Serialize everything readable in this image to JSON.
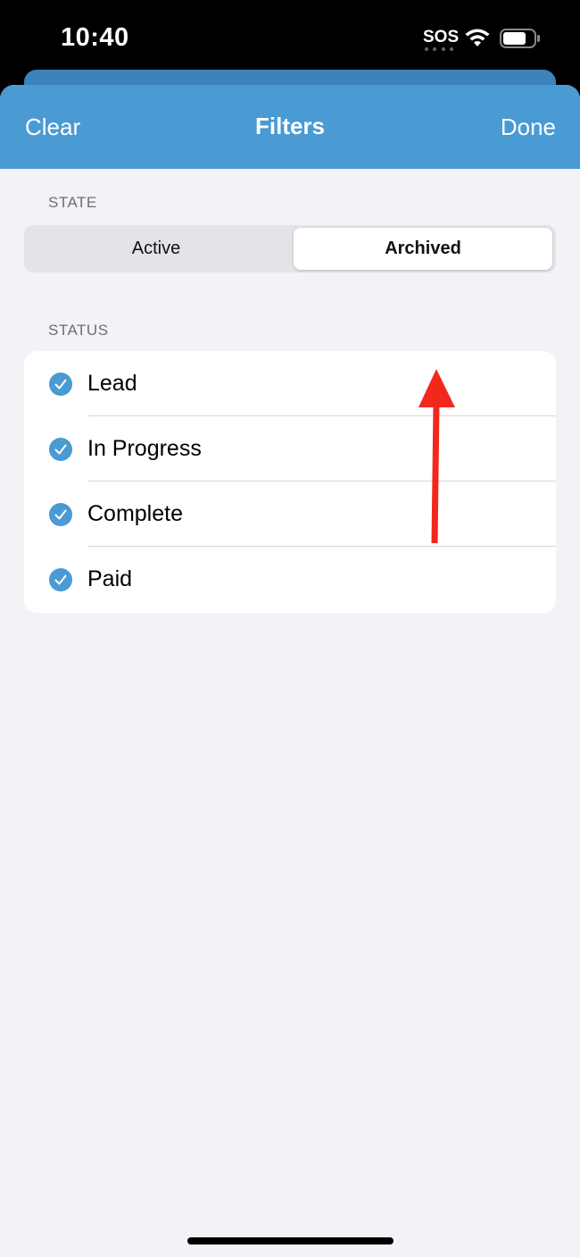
{
  "status_bar": {
    "time": "10:40",
    "sos": "SOS",
    "wifi_icon": "wifi-icon",
    "battery_icon": "battery-icon"
  },
  "nav": {
    "left_button": "Clear",
    "title": "Filters",
    "right_button": "Done",
    "background_color": "#4A9AD4"
  },
  "state_section": {
    "header": "STATE",
    "segments": [
      "Active",
      "Archived"
    ],
    "selected": "Archived"
  },
  "status_section": {
    "header": "STATUS",
    "items": [
      {
        "label": "Lead",
        "checked": true,
        "icon": "checkmark-circle-icon"
      },
      {
        "label": "In Progress",
        "checked": true,
        "icon": "checkmark-circle-icon"
      },
      {
        "label": "Complete",
        "checked": true,
        "icon": "checkmark-circle-icon"
      },
      {
        "label": "Paid",
        "checked": true,
        "icon": "checkmark-circle-icon"
      }
    ],
    "check_color": "#4A9AD4"
  },
  "annotation": {
    "type": "red-arrow",
    "color": "#F2281D",
    "points_to": "Archived"
  }
}
